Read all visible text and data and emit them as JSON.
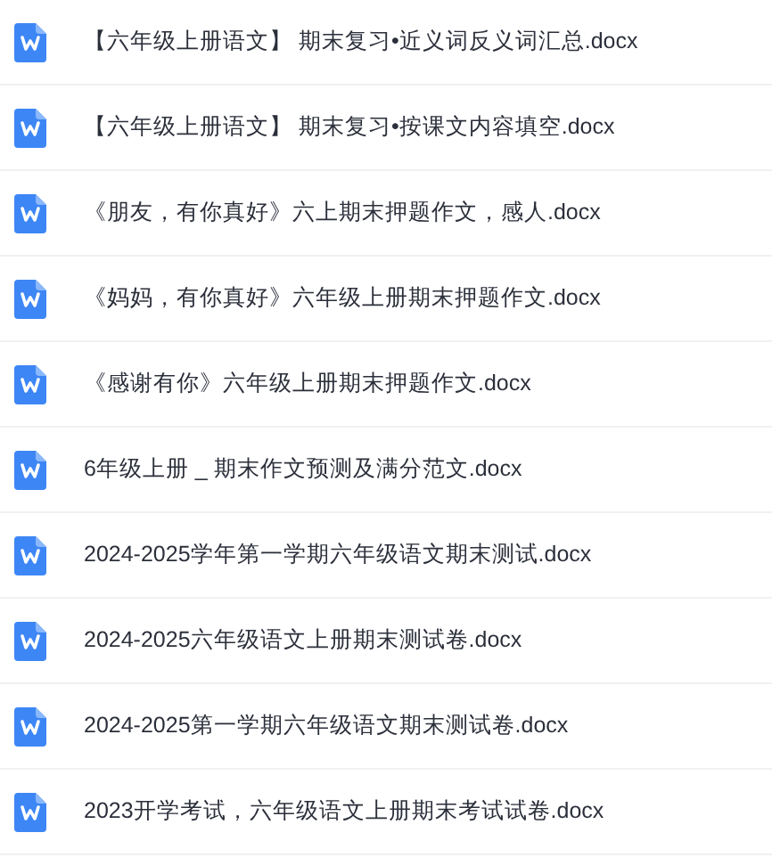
{
  "files": [
    {
      "name": "【六年级上册语文】 期末复习•近义词反义词汇总.docx"
    },
    {
      "name": "【六年级上册语文】 期末复习•按课文内容填空.docx"
    },
    {
      "name": "《朋友，有你真好》六上期末押题作文，感人.docx"
    },
    {
      "name": "《妈妈，有你真好》六年级上册期末押题作文.docx"
    },
    {
      "name": "《感谢有你》六年级上册期末押题作文.docx"
    },
    {
      "name": "6年级上册 _ 期末作文预测及满分范文.docx"
    },
    {
      "name": "2024-2025学年第一学期六年级语文期末测试.docx"
    },
    {
      "name": "2024-2025六年级语文上册期末测试卷.docx"
    },
    {
      "name": "2024-2025第一学期六年级语文期末测试卷.docx"
    },
    {
      "name": "2023开学考试，六年级语文上册期末考试试卷.docx"
    }
  ]
}
